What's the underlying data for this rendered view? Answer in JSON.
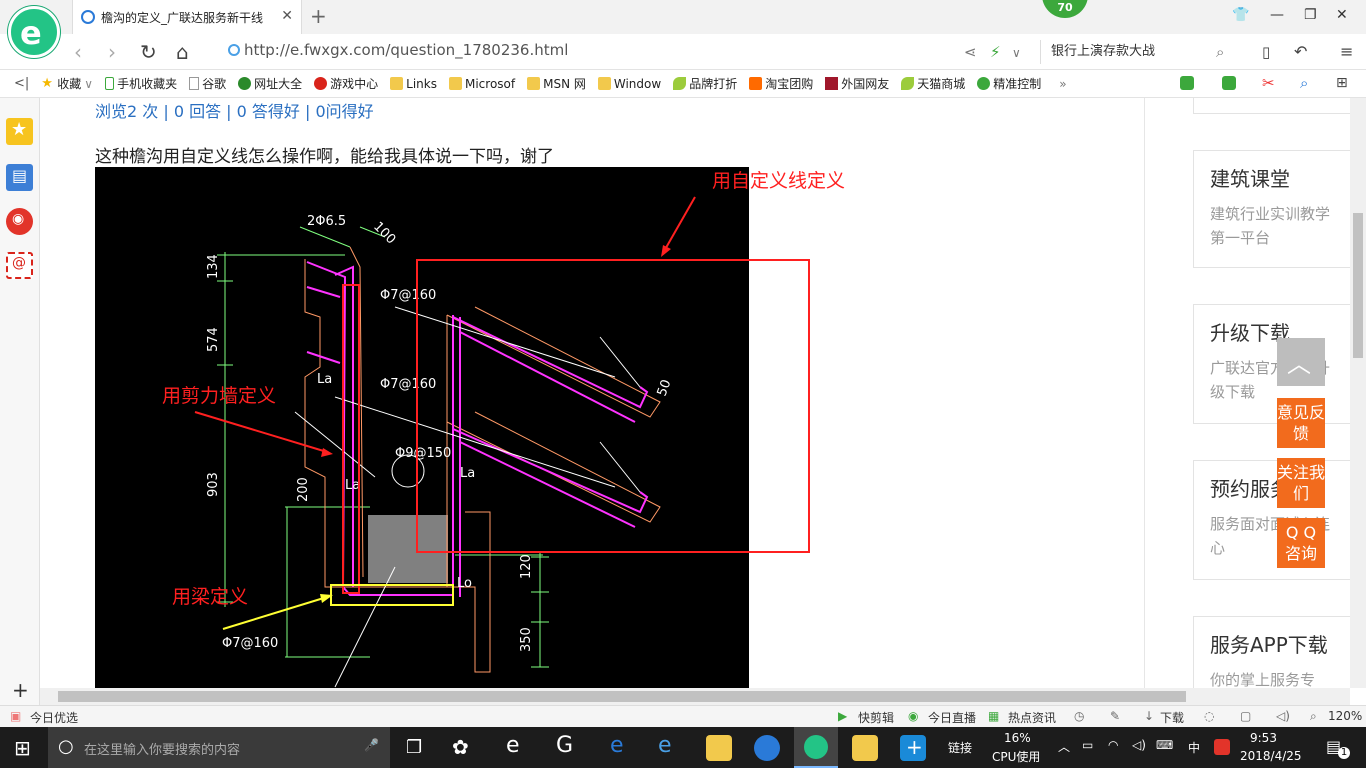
{
  "browser": {
    "tab_title": "檐沟的定义_广联达服务新干线",
    "badge": "70",
    "url": "http://e.fwxgx.com/question_1780236.html",
    "search_text": "银行上演存款大战"
  },
  "bookmarks": [
    "收藏",
    "手机收藏夹",
    "谷歌",
    "网址大全",
    "游戏中心",
    "Links",
    "Microsof",
    "MSN 网",
    "Window",
    "品牌打折",
    "淘宝团购",
    "外国网友",
    "天猫商城",
    "精准控制"
  ],
  "page": {
    "stats": "浏览2 次 | 0 回答 | 0 答得好 | 0问得好",
    "question": "这种檐沟用自定义线怎么操作啊，能给我具体说一下吗，谢了",
    "annotations": {
      "custom_line": "用自定义线定义",
      "shear_wall": "用剪力墙定义",
      "beam": "用梁定义"
    },
    "cad_labels": {
      "t1": "2Φ6.5",
      "t2": "Φ7@160",
      "t3": "Φ7@160",
      "t4": "Φ9@150",
      "t5": "Φ7@160",
      "la1": "La",
      "la2": "La",
      "la3": "La",
      "lo": "Lo",
      "d134": "134",
      "d574": "574",
      "d903": "903",
      "d200": "200",
      "d120": "120",
      "d350": "350",
      "d100": "100",
      "d50": "50"
    }
  },
  "right_cards": [
    {
      "title": "建筑课堂",
      "text": "建筑行业实训教学第一平台"
    },
    {
      "title": "升级下载",
      "text": "广联达官方指定升级下载"
    },
    {
      "title": "预约服务",
      "text": "服务面对面诚心连心"
    },
    {
      "title": "服务APP下载",
      "text": "你的掌上服务专"
    }
  ],
  "float_buttons": [
    "意见反馈",
    "关注我们",
    "Q Q 咨询"
  ],
  "statusbar": {
    "left": "今日优选",
    "items": [
      "快剪辑",
      "今日直播",
      "热点资讯",
      "下载"
    ],
    "zoom": "120%"
  },
  "taskbar": {
    "search_placeholder": "在这里输入你要搜索的内容",
    "link_label": "链接",
    "cpu_percent": "16%",
    "cpu_label": "CPU使用",
    "ime": "中",
    "time": "9:53",
    "date": "2018/4/25",
    "notif": "1"
  },
  "colors": {
    "accent_green": "#23c486",
    "link_blue": "#2a6fc1",
    "float_orange": "#f26b1d",
    "annot_red": "#ff2020",
    "annot_yellow": "#ffff33",
    "cad_magenta": "#ff33ff",
    "cad_green": "#7fff7f"
  }
}
